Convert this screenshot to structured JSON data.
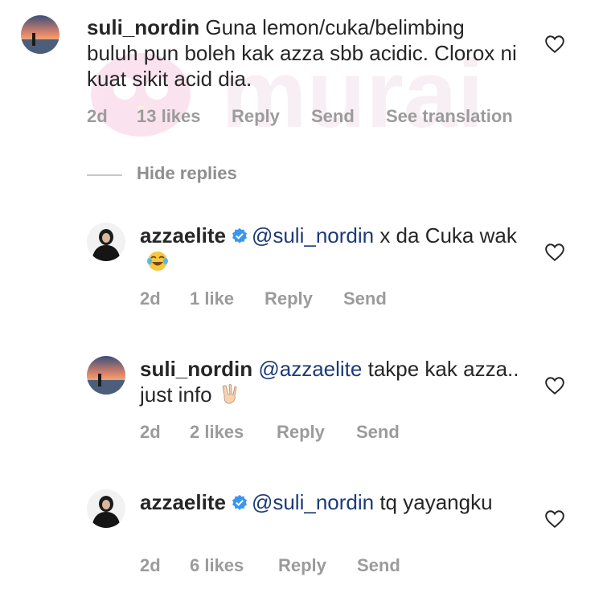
{
  "watermark": {
    "text": "murai"
  },
  "comments": [
    {
      "username": "suli_nordin",
      "text": "Guna lemon/cuka/belimbing buluh pun boleh kak azza sbb acidic. Clorox ni kuat sikit acid dia.",
      "time": "2d",
      "likes": "13 likes",
      "reply": "Reply",
      "send": "Send",
      "translate": "See translation"
    }
  ],
  "hide_replies": "Hide replies",
  "replies": [
    {
      "username": "azzaelite",
      "mention": "@suli_nordin",
      "text": "x da Cuka wak",
      "emoji": "face-with-tears-of-joy",
      "time": "2d",
      "likes": "1 like",
      "reply": "Reply",
      "send": "Send"
    },
    {
      "username": "suli_nordin",
      "mention": "@azzaelite",
      "text": "takpe kak azza.. just info",
      "emoji": "victory-hand",
      "time": "2d",
      "likes": "2 likes",
      "reply": "Reply",
      "send": "Send"
    },
    {
      "username": "azzaelite",
      "mention": "@suli_nordin",
      "text": "tq yayangku",
      "time": "2d",
      "likes": "6 likes",
      "reply": "Reply",
      "send": "Send"
    }
  ],
  "colors": {
    "mention": "#1c3b77",
    "meta": "#9b9b9b",
    "verified": "#3897f0"
  }
}
